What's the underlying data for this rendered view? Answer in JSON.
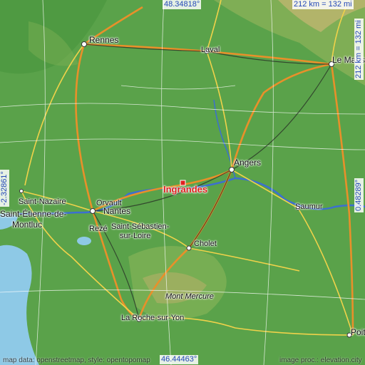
{
  "map": {
    "focus_place": "Ingrandes",
    "colors": {
      "focus": "#e02020",
      "coords": "#2448b8",
      "water": "#8ec9e6",
      "land": "#5aa24a"
    },
    "coords": {
      "top_lat": "48.34818°",
      "bottom_lat": "46.44463°",
      "left_lon": "-2.32861°",
      "right_lon": "0.48289°",
      "scale_h": "212 km = 132 mi",
      "scale_v": "212 km = 132 mi"
    },
    "cities": [
      "Rennes",
      "Laval",
      "Le Mans",
      "Angers",
      "Saint-Nazaire",
      "Saint-Étienne-de-",
      "Montluc",
      "Nantes",
      "Orvault",
      "Rezé",
      "Saint-Sébastien-",
      "sur-Loire",
      "Saumur",
      "Cholet",
      "Mont Mercure",
      "La Roche-sur-Yon",
      "Poit"
    ],
    "credits": {
      "left": "map data: openstreetmap, style: opentopomap",
      "right": "image proc.: elevation.city"
    }
  }
}
